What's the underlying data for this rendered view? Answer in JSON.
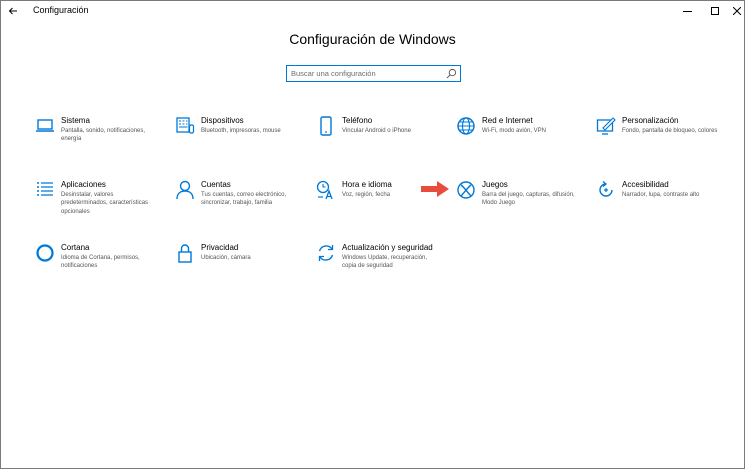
{
  "window": {
    "title": "Configuración",
    "back_icon": "back-arrow-icon",
    "minimize": "—",
    "maximize": "☐",
    "close": "✕"
  },
  "page_title": "Configuración de Windows",
  "search": {
    "placeholder": "Buscar una configuración",
    "icon": "search-icon"
  },
  "accent_color": "#0078d7",
  "pointer_arrow_color": "#e84c3d",
  "tiles": [
    {
      "title": "Sistema",
      "desc": "Pantalla, sonido, notificaciones, energía",
      "icon": "laptop-icon"
    },
    {
      "title": "Dispositivos",
      "desc": "Bluetooth, impresoras, mouse",
      "icon": "keyboard-icon"
    },
    {
      "title": "Teléfono",
      "desc": "Vincular Android o iPhone",
      "icon": "phone-icon"
    },
    {
      "title": "Red e Internet",
      "desc": "Wi-Fi, modo avión, VPN",
      "icon": "globe-icon"
    },
    {
      "title": "Personalización",
      "desc": "Fondo, pantalla de bloqueo, colores",
      "icon": "paint-icon"
    },
    {
      "title": "Aplicaciones",
      "desc": "Desinstalar, valores predeterminados, características opcionales",
      "icon": "apps-list-icon"
    },
    {
      "title": "Cuentas",
      "desc": "Tus cuentas, correo electrónico, sincronizar, trabajo, familia",
      "icon": "person-icon"
    },
    {
      "title": "Hora e idioma",
      "desc": "Voz, región, fecha",
      "icon": "time-language-icon"
    },
    {
      "title": "Juegos",
      "desc": "Barra del juego, capturas, difusión, Modo Juego",
      "icon": "xbox-icon"
    },
    {
      "title": "Accesibilidad",
      "desc": "Narrador, lupa, contraste alto",
      "icon": "accessibility-icon"
    },
    {
      "title": "Cortana",
      "desc": "Idioma de Cortana, permisos, notificaciones",
      "icon": "cortana-icon"
    },
    {
      "title": "Privacidad",
      "desc": "Ubicación, cámara",
      "icon": "lock-icon"
    },
    {
      "title": "Actualización y seguridad",
      "desc": "Windows Update, recuperación, copia de seguridad",
      "icon": "update-icon"
    }
  ]
}
